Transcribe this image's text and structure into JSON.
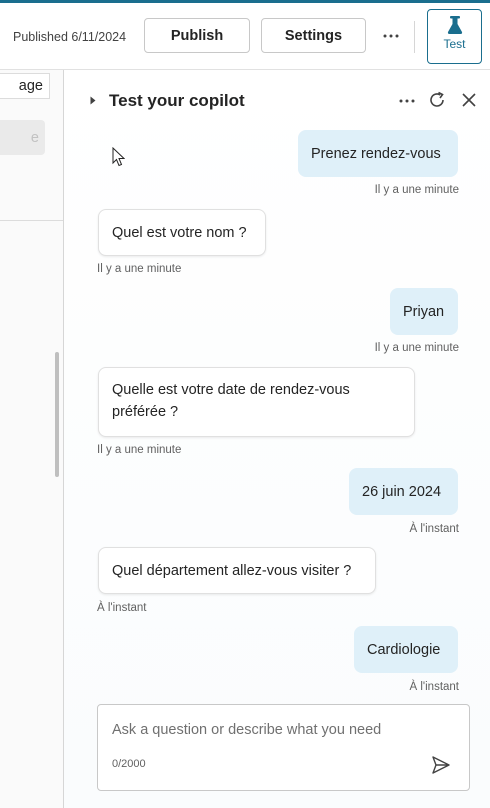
{
  "header": {
    "published_label": "Published 6/11/2024",
    "publish_label": "Publish",
    "settings_label": "Settings",
    "more_icon": "more-horizontal-icon",
    "test_label": "Test",
    "test_icon": "flask-icon",
    "accent_color": "#1a6e8e"
  },
  "left_pane": {
    "page_input_value": "age",
    "gray_button_label": "e"
  },
  "test_panel": {
    "title": "Test your copilot",
    "messages": [
      {
        "role": "user",
        "text": "Prenez rendez-vous",
        "time": "Il y a une minute"
      },
      {
        "role": "bot",
        "text": "Quel est votre nom ?",
        "time": "Il y a une minute"
      },
      {
        "role": "user",
        "text": "Priyan",
        "time": "Il y a une minute"
      },
      {
        "role": "bot",
        "text": "Quelle est votre date de rendez-vous préférée ?",
        "time": "Il y a une minute"
      },
      {
        "role": "user",
        "text": "26 juin 2024",
        "time": "À l'instant"
      },
      {
        "role": "bot",
        "text": "Quel département allez-vous visiter ?",
        "time": "À l'instant"
      },
      {
        "role": "user",
        "text": "Cardiologie",
        "time": "À l'instant"
      }
    ],
    "composer": {
      "placeholder": "Ask a question or describe what you need",
      "char_count": "0/2000"
    },
    "user_bubble_color": "#dff0f9"
  }
}
